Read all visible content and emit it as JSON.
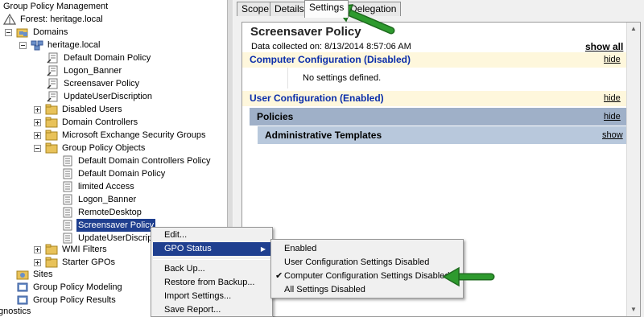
{
  "tree": {
    "root_label": "Group Policy Management",
    "items": [
      {
        "label": "Forest: heritage.local"
      },
      {
        "label": "Domains"
      },
      {
        "label": "heritage.local"
      },
      {
        "label": "Default Domain Policy"
      },
      {
        "label": "Logon_Banner"
      },
      {
        "label": "Screensaver Policy"
      },
      {
        "label": "UpdateUserDiscription"
      },
      {
        "label": "Disabled Users"
      },
      {
        "label": "Domain Controllers"
      },
      {
        "label": "Microsoft Exchange Security Groups"
      },
      {
        "label": "Group Policy Objects"
      },
      {
        "label": "Default Domain Controllers Policy"
      },
      {
        "label": "Default Domain Policy"
      },
      {
        "label": "limited Access"
      },
      {
        "label": "Logon_Banner"
      },
      {
        "label": "RemoteDesktop"
      },
      {
        "label": "Screensaver Policy"
      },
      {
        "label": "UpdateUserDiscript"
      },
      {
        "label": "WMI Filters"
      },
      {
        "label": "Starter GPOs"
      },
      {
        "label": "Sites"
      },
      {
        "label": "Group Policy Modeling"
      },
      {
        "label": "Group Policy Results"
      },
      {
        "label": "gnostics"
      }
    ]
  },
  "tabs": [
    {
      "label": "Scope"
    },
    {
      "label": "Details"
    },
    {
      "label": "Settings"
    },
    {
      "label": "Delegation"
    }
  ],
  "report": {
    "title": "Screensaver Policy",
    "collected": "Data collected on: 8/13/2014 8:57:06 AM",
    "show_all": "show all",
    "computer_config": "Computer Configuration (Disabled)",
    "computer_link": "hide",
    "no_settings": "No settings defined.",
    "user_config": "User Configuration (Enabled)",
    "user_link": "hide",
    "policies": "Policies",
    "policies_link": "hide",
    "admin_templates": "Administrative Templates",
    "admin_link": "show"
  },
  "context_menu": {
    "items": [
      {
        "label": "Edit..."
      },
      {
        "label": "GPO Status"
      },
      {
        "label": "Back Up..."
      },
      {
        "label": "Restore from Backup..."
      },
      {
        "label": "Import Settings..."
      },
      {
        "label": "Save Report..."
      }
    ]
  },
  "submenu": {
    "items": [
      {
        "label": "Enabled"
      },
      {
        "label": "User Configuration Settings Disabled"
      },
      {
        "label": "Computer Configuration Settings Disabled",
        "checked": true
      },
      {
        "label": "All Settings Disabled"
      }
    ],
    "check_glyph": "✔"
  },
  "colors": {
    "selection": "#1f3f8f",
    "annotation_arrow": "#2e9a2e",
    "section_band": "#fef7dc",
    "policies_band": "#9fb0c8",
    "templates_band": "#b8c8dc"
  }
}
